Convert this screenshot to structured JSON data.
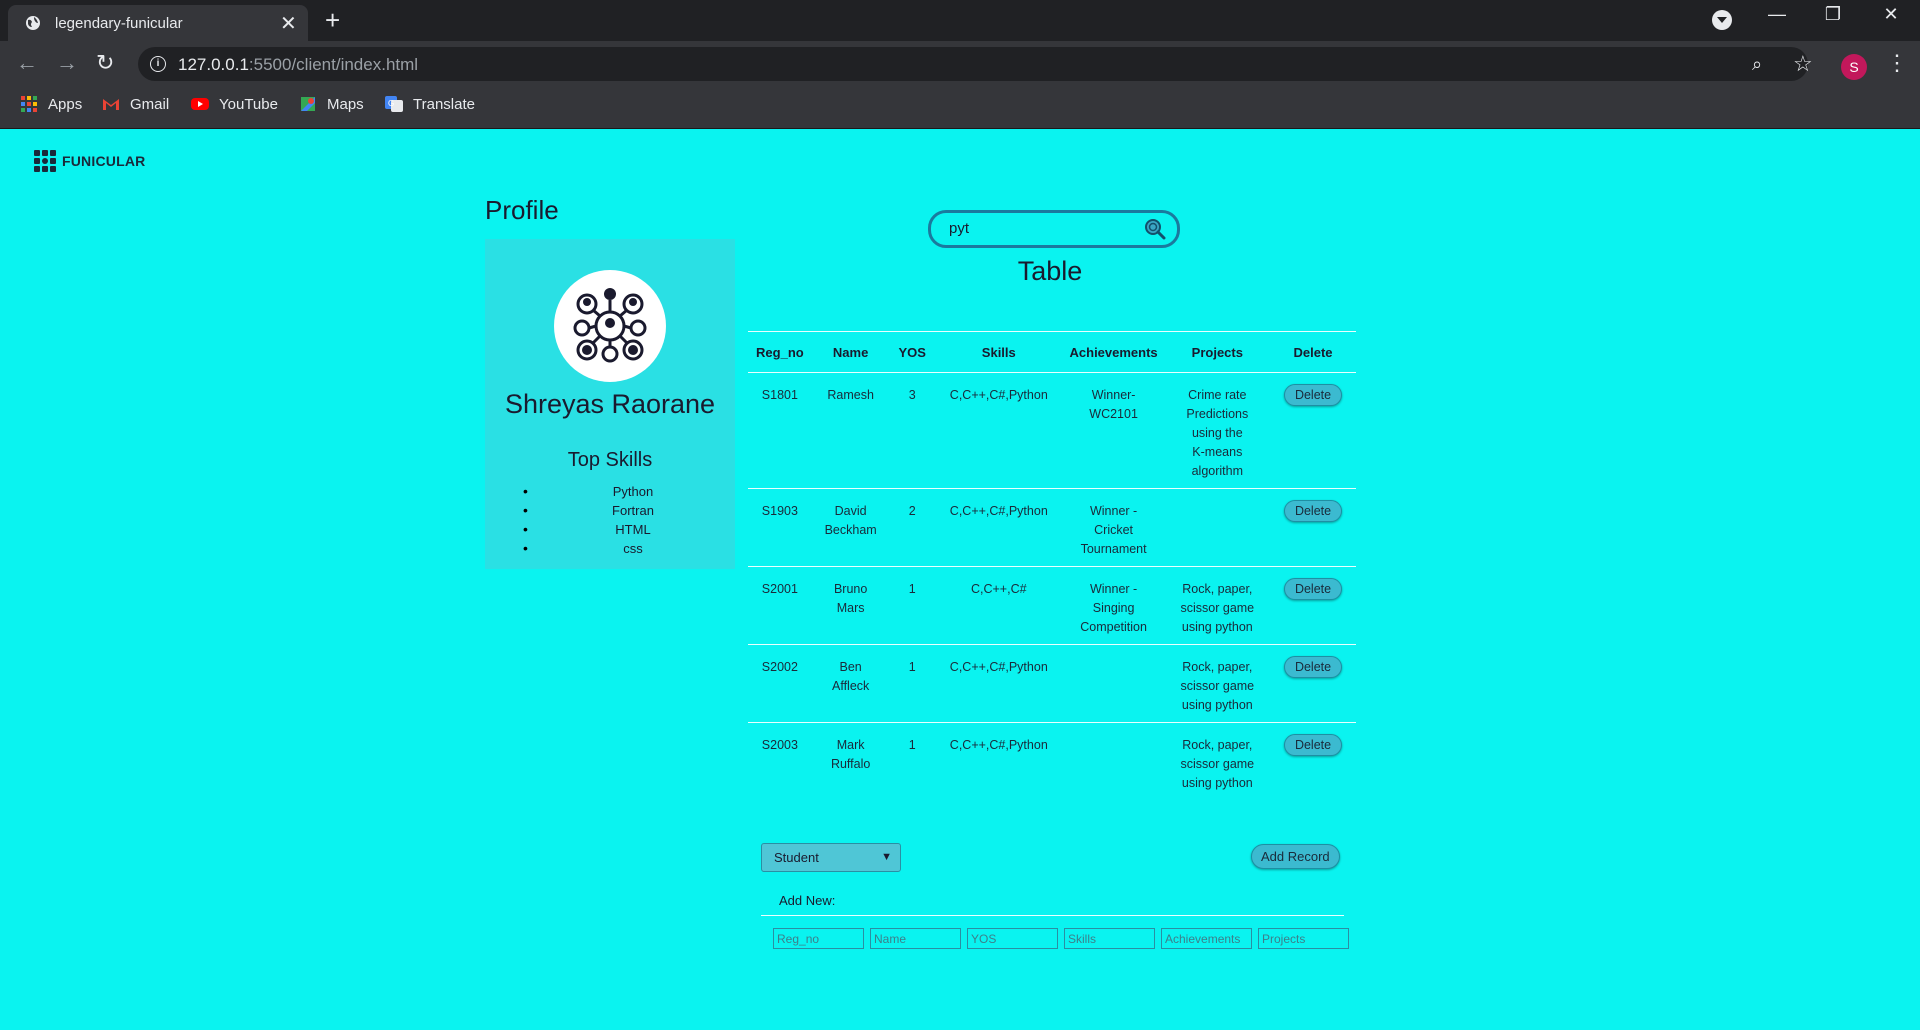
{
  "browser": {
    "tab_title": "legendary-funicular",
    "url_host": "127.0.0.1",
    "url_path": ":5500/client/index.html",
    "profile_initial": "S",
    "bookmarks": [
      "Apps",
      "Gmail",
      "YouTube",
      "Maps",
      "Translate"
    ]
  },
  "brand": {
    "logo_text": "FUNICULAR"
  },
  "profile": {
    "heading": "Profile",
    "name": "Shreyas Raorane",
    "top_skills_heading": "Top Skills",
    "skills": [
      "Python",
      "Fortran",
      "HTML",
      "css"
    ]
  },
  "search": {
    "value": "pyt"
  },
  "table": {
    "title": "Table",
    "columns": [
      "Reg_no",
      "Name",
      "YOS",
      "Skills",
      "Achievements",
      "Projects",
      "Delete"
    ],
    "delete_label": "Delete",
    "rows": [
      {
        "reg_no": "S1801",
        "name": "Ramesh",
        "yos": "3",
        "skills": "C,C++,C#,Python",
        "achievements": "Winner- WC2101",
        "projects": "Crime rate Predictions using the K-means algorithm"
      },
      {
        "reg_no": "S1903",
        "name": "David Beckham",
        "yos": "2",
        "skills": "C,C++,C#,Python",
        "achievements": "Winner - Cricket Tournament",
        "projects": ""
      },
      {
        "reg_no": "S2001",
        "name": "Bruno Mars",
        "yos": "1",
        "skills": "C,C++,C#",
        "achievements": "Winner - Singing Competition",
        "projects": "Rock, paper, scissor game using python"
      },
      {
        "reg_no": "S2002",
        "name": "Ben Affleck",
        "yos": "1",
        "skills": "C,C++,C#,Python",
        "achievements": "",
        "projects": "Rock, paper, scissor game using python"
      },
      {
        "reg_no": "S2003",
        "name": "Mark Ruffalo",
        "yos": "1",
        "skills": "C,C++,C#,Python",
        "achievements": "",
        "projects": "Rock, paper, scissor game using python"
      }
    ]
  },
  "form": {
    "select_value": "Student",
    "add_record_label": "Add Record",
    "add_new_label": "Add New:",
    "placeholders": [
      "Reg_no",
      "Name",
      "YOS",
      "Skills",
      "Achievements",
      "Projects"
    ]
  }
}
